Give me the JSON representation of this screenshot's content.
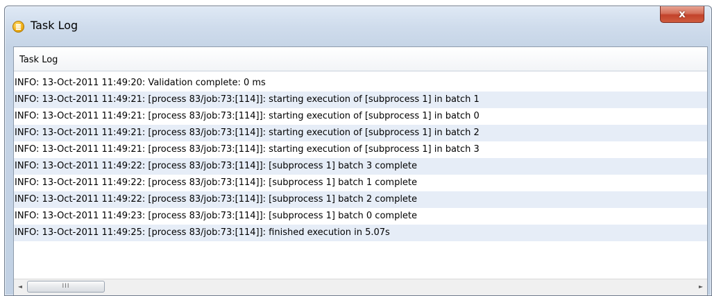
{
  "window": {
    "title": "Task Log",
    "close_label": "x",
    "icon": "task-log-app-icon"
  },
  "panel": {
    "header_label": "Task Log"
  },
  "log": {
    "lines": [
      "INFO: 13-Oct-2011 11:49:20: Validation complete: 0 ms",
      "INFO: 13-Oct-2011 11:49:21: [process 83/job:73:[114]]: starting execution of [subprocess 1] in batch 1",
      "INFO: 13-Oct-2011 11:49:21: [process 83/job:73:[114]]: starting execution of [subprocess 1] in batch 0",
      "INFO: 13-Oct-2011 11:49:21: [process 83/job:73:[114]]: starting execution of [subprocess 1] in batch 2",
      "INFO: 13-Oct-2011 11:49:21: [process 83/job:73:[114]]: starting execution of [subprocess 1] in batch 3",
      "INFO: 13-Oct-2011 11:49:22: [process 83/job:73:[114]]: [subprocess 1] batch 3 complete",
      "INFO: 13-Oct-2011 11:49:22: [process 83/job:73:[114]]: [subprocess 1] batch 1 complete",
      "INFO: 13-Oct-2011 11:49:22: [process 83/job:73:[114]]: [subprocess 1] batch 2 complete",
      "INFO: 13-Oct-2011 11:49:23: [process 83/job:73:[114]]: [subprocess 1] batch 0 complete",
      "INFO: 13-Oct-2011 11:49:25: [process 83/job:73:[114]]: finished execution in 5.07s"
    ]
  },
  "scrollbar": {
    "left_arrow": "◄",
    "right_arrow": "►",
    "thumb_grip": "III"
  }
}
